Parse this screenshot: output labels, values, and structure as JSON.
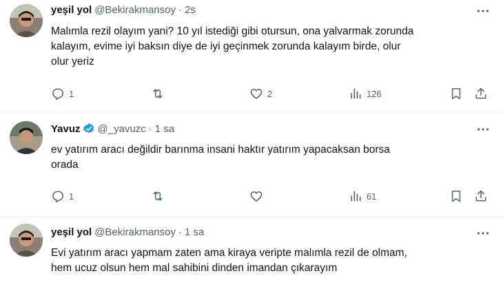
{
  "tweets": [
    {
      "name": "yeşil yol",
      "handle": "@Bekirakmansoy",
      "dot": "·",
      "time": "2s",
      "verified": false,
      "text_lines": [
        "Malımla rezil olayım yani? 10 yıl istediği gibi otursun, ona yalvarmak zorunda",
        "kalayım, evime iyi baksın diye de iyi geçinmek zorunda kalayım birde, olur",
        "olur yeriz"
      ],
      "replies": "1",
      "retweets": "",
      "likes": "2",
      "views": "126"
    },
    {
      "name": "Yavuz",
      "handle": "@_yavuzc",
      "dot": "·",
      "time": "1 sa",
      "verified": true,
      "text_lines": [
        "ev yatırım aracı değildir barınma insani haktır yatırım yapacaksan borsa",
        "orada"
      ],
      "replies": "1",
      "retweets": "",
      "likes": "",
      "views": "61"
    },
    {
      "name": "yeşil yol",
      "handle": "@Bekirakmansoy",
      "dot": "·",
      "time": "1 sa",
      "verified": false,
      "text_lines": [
        "Evi yatırım aracı yapmam zaten ama kiraya veripte malımla rezil de olmam,",
        "hem ucuz olsun hem mal sahibini dinden imandan çıkarayım"
      ]
    }
  ],
  "icons": {
    "reply": "reply-icon",
    "retweet": "retweet-icon",
    "like": "heart-icon",
    "views": "views-icon",
    "bookmark": "bookmark-icon",
    "share": "share-icon",
    "more": "more-icon",
    "verified": "verified-badge-icon"
  },
  "colors": {
    "text": "#0f1419",
    "secondary": "#536471",
    "verified": "#1d9bf0",
    "divider": "#eff3f4"
  }
}
